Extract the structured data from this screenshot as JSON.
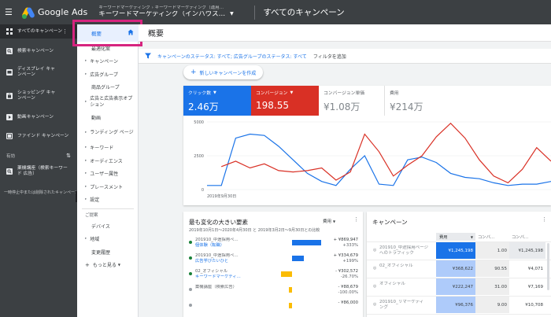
{
  "topbar": {
    "app_name": "Google Ads",
    "breadcrumbs": "キーワードマーケティング › キーワードマーケティング（運用…",
    "account_name": "キーワードマーケティング（インハウス…",
    "page_heading": "すべてのキャンペーン"
  },
  "leftnav": {
    "items": [
      {
        "label": "すべてのキャンペーン",
        "icon": "grid-icon"
      },
      {
        "label": "検索キャンペーン",
        "icon": "search-campaign-icon"
      },
      {
        "label": "ディスプレイ キャンペーン",
        "icon": "display-campaign-icon"
      },
      {
        "label": "ショッピング キャンペーン",
        "icon": "shopping-campaign-icon"
      },
      {
        "label": "動画キャンペーン",
        "icon": "video-campaign-icon"
      },
      {
        "label": "ファインド キャンペーン",
        "icon": "discovery-campaign-icon"
      }
    ],
    "enabled_label": "有効",
    "enabled_campaign": "薬機講座（検索キーワード 広告）",
    "note": "一時停止中または削除されたキャンペーン"
  },
  "subnav": {
    "active": "概要",
    "items": [
      {
        "label": "最適化案",
        "arrow": false
      },
      {
        "label": "キャンペーン",
        "arrow": true
      },
      {
        "label": "広告グループ",
        "arrow": true
      },
      {
        "label": "商品グループ",
        "arrow": false
      },
      {
        "label": "広告と広告表示オプション",
        "arrow": true,
        "two": true
      },
      {
        "label": "動画",
        "arrow": false
      },
      {
        "label": "ランディング ページ",
        "arrow": true,
        "two": true
      },
      {
        "label": "キーワード",
        "arrow": true
      },
      {
        "label": "オーディエンス",
        "arrow": true
      },
      {
        "label": "ユーザー属性",
        "arrow": true
      },
      {
        "label": "プレースメント",
        "arrow": true
      },
      {
        "label": "設定",
        "arrow": true
      }
    ],
    "group_label": "ご提案",
    "items2": [
      {
        "label": "デバイス",
        "arrow": false
      },
      {
        "label": "地域",
        "arrow": true
      },
      {
        "label": "変更履歴",
        "arrow": false
      }
    ],
    "more": "もっと見る"
  },
  "main": {
    "title": "概要",
    "filter_text": "キャンペーンのステータス: すべて; 広告グループのステータス: すべて",
    "add_filter": "フィルタを追加",
    "new_campaign": "新しいキャンペーンを作成",
    "metrics": [
      {
        "label": "クリック数",
        "value": "2.46万"
      },
      {
        "label": "コンバージョン",
        "value": "198.55"
      },
      {
        "label": "コンバージョン単価",
        "value": "¥1.08万"
      },
      {
        "label": "費用",
        "value": "¥214万"
      }
    ],
    "chart_date_label": "2019年9月30日"
  },
  "chart_data": {
    "type": "line",
    "yticks": [
      "5000",
      "2500",
      "0"
    ],
    "ylim": [
      0,
      5000
    ],
    "x_label": "2019年9月30日",
    "series": [
      {
        "name": "クリック数",
        "color": "#1a73e8",
        "values": [
          300,
          300,
          3800,
          4100,
          4000,
          3200,
          2200,
          1200,
          600,
          300,
          1500,
          2500,
          400,
          300,
          2200,
          2400,
          2000,
          1200,
          900,
          800,
          500,
          300,
          400,
          400,
          600
        ]
      },
      {
        "name": "コンバージョン",
        "color": "#d93025",
        "values": [
          null,
          1700,
          2100,
          1600,
          1900,
          1400,
          1300,
          1400,
          1600,
          700,
          1300,
          4100,
          2800,
          1000,
          1800,
          2500,
          3900,
          4900,
          3800,
          2200,
          1000,
          500,
          1500,
          3100,
          2100
        ]
      }
    ]
  },
  "card2": {
    "title": "最も変化の大きい要素",
    "sort_label": "費用",
    "subtitle": "2019年10月1日～2020年4月30日 と 2019年3月2日～9月30日との比較",
    "rows": [
      {
        "name1": "201910_中途採用ペ…",
        "name2": "個体験（転職）",
        "value": "+ ¥869,947",
        "pct": "+333%",
        "status": "#188038",
        "bar": 0.92,
        "bar_color": "#1a73e8"
      },
      {
        "name1": "201910_中途採用ペ…",
        "name2": "広告学びたいひと",
        "value": "+ ¥334,679",
        "pct": "+199%",
        "status": "#188038",
        "bar": 0.38,
        "bar_color": "#1a73e8"
      },
      {
        "name1": "02_オフィシャル",
        "name2": "キーワードマーケティ…",
        "value": "- ¥302,572",
        "pct": "-26.70%",
        "status": "#188038",
        "bar": 0.34,
        "bar_color": "#fbbc04"
      },
      {
        "name1": "薬機講座（検索広告）",
        "name2": "",
        "value": "- ¥88,679",
        "pct": "-100.00%",
        "status": "#9aa0a6",
        "bar": 0.11,
        "bar_color": "#fbbc04"
      },
      {
        "name1": "",
        "name2": "",
        "value": "- ¥86,000",
        "pct": "",
        "status": "#9aa0a6",
        "bar": 0.1,
        "bar_color": "#fbbc04"
      }
    ]
  },
  "card3": {
    "title": "キャンペーン",
    "headers": [
      "費用",
      "コンバ…",
      "コンバ…"
    ],
    "rows": [
      {
        "name1": "201910_中途採用ページ",
        "name2": "へのトラフィック",
        "cost": "¥1,245,198",
        "conv": "1.00",
        "cost2": "¥1,245,198",
        "highlight": true
      },
      {
        "name1": "02_オフィシャル",
        "name2": "",
        "cost": "¥368,622",
        "conv": "90.55",
        "cost2": "¥4,071"
      },
      {
        "name1": "オフィシャル",
        "name2": "",
        "cost": "¥222,247",
        "conv": "31.00",
        "cost2": "¥7,169"
      },
      {
        "name1": "201910_リマーケティ",
        "name2": "ング",
        "cost": "¥96,376",
        "conv": "9.00",
        "cost2": "¥10,708"
      },
      {
        "name1": "",
        "name2": "",
        "cost": "",
        "conv": "",
        "cost2": ""
      }
    ]
  }
}
